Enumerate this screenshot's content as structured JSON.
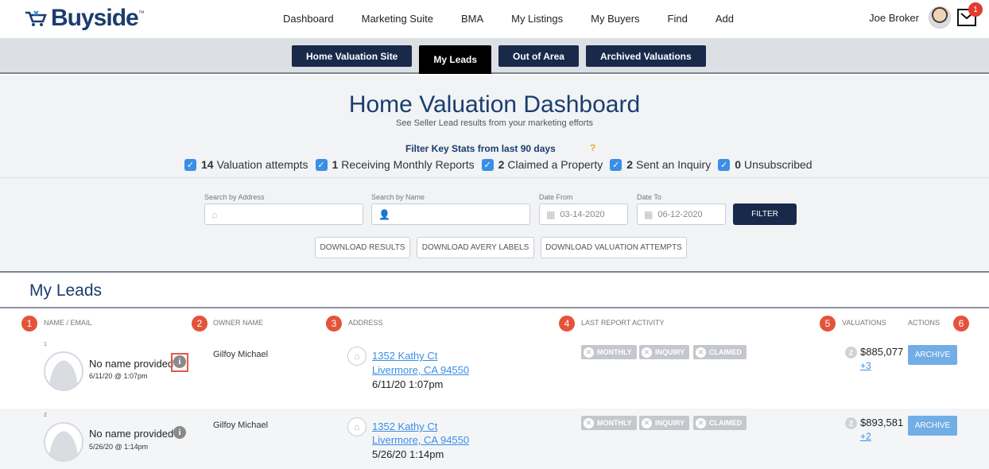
{
  "brand": {
    "name": "Buyside",
    "tm": "™"
  },
  "nav": {
    "items": [
      "Dashboard",
      "Marketing Suite",
      "BMA",
      "My Listings",
      "My Buyers",
      "Find",
      "Add"
    ],
    "user_name": "Joe Broker",
    "mail_badge": "1"
  },
  "tabs": [
    "Home Valuation Site",
    "My Leads",
    "Out of Area",
    "Archived Valuations"
  ],
  "dashboard": {
    "title": "Home Valuation Dashboard",
    "subtitle": "See Seller Lead results from your marketing efforts",
    "filter_title": "Filter Key Stats from last 90 days",
    "help": "?",
    "stats": [
      {
        "count": "14",
        "label": "Valuation attempts"
      },
      {
        "count": "1",
        "label": "Receiving Monthly Reports"
      },
      {
        "count": "2",
        "label": "Claimed a Property"
      },
      {
        "count": "2",
        "label": "Sent an Inquiry"
      },
      {
        "count": "0",
        "label": "Unsubscribed"
      }
    ]
  },
  "search": {
    "address_label": "Search by Address",
    "name_label": "Search by Name",
    "date_from_label": "Date From",
    "date_from_value": "03-14-2020",
    "date_to_label": "Date To",
    "date_to_value": "06-12-2020",
    "filter_button": "FILTER",
    "download_results": "DOWNLOAD RESULTS",
    "download_avery": "DOWNLOAD AVERY LABELS",
    "download_attempts": "DOWNLOAD VALUATION ATTEMPTS"
  },
  "leads": {
    "title": "My Leads",
    "columns": {
      "name": "NAME / EMAIL",
      "owner": "OWNER NAME",
      "address": "ADDRESS",
      "activity": "LAST REPORT ACTIVITY",
      "valuations": "VALUATIONS",
      "actions": "ACTIONS"
    },
    "markers": [
      "1",
      "2",
      "3",
      "4",
      "5",
      "6"
    ],
    "pill_labels": {
      "monthly": "MONTHLY",
      "inquiry": "INQUIRY",
      "claimed": "CLAIMED"
    },
    "archive_label": "ARCHIVE",
    "rows": [
      {
        "index": "1",
        "name": "No name provided",
        "date": "6/11/20 @ 1:07pm",
        "owner": "Gilfoy Michael",
        "street": "1352 Kathy Ct",
        "city": "Livermore, CA 94550",
        "addr_date": "6/11/20 1:07pm",
        "valuation": "$885,077",
        "more": "+3"
      },
      {
        "index": "2",
        "name": "No name provided",
        "date": "5/26/20 @ 1:14pm",
        "owner": "Gilfoy Michael",
        "street": "1352 Kathy Ct",
        "city": "Livermore, CA 94550",
        "addr_date": "5/26/20 1:14pm",
        "valuation": "$893,581",
        "more": "+2"
      }
    ]
  }
}
